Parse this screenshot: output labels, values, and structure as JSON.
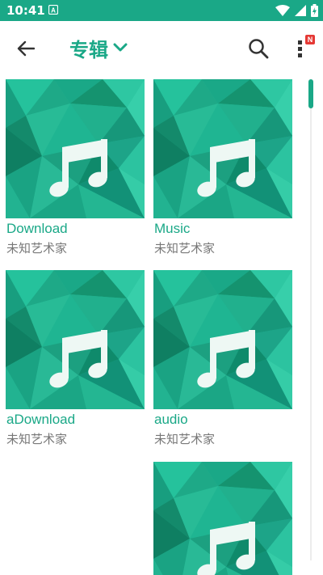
{
  "status_bar": {
    "time": "10:41",
    "icons": [
      "a-app-icon",
      "wifi-icon",
      "signal-icon",
      "battery-charging-icon"
    ]
  },
  "app_bar": {
    "title": "专辑",
    "back_icon": "arrow-left-icon",
    "dropdown_icon": "chevron-down-icon",
    "search_icon": "search-icon",
    "more_icon": "more-vert-icon",
    "badge": "N"
  },
  "albums": [
    {
      "title": "Download",
      "artist": "未知艺术家",
      "cover_icon": "music-note-icon"
    },
    {
      "title": "Music",
      "artist": "未知艺术家",
      "cover_icon": "music-note-icon"
    },
    {
      "title": "aDownload",
      "artist": "未知艺术家",
      "cover_icon": "music-note-icon"
    },
    {
      "title": "audio",
      "artist": "未知艺术家",
      "cover_icon": "music-note-icon"
    },
    {
      "title": "",
      "artist": "",
      "cover_icon": "music-note-icon"
    }
  ],
  "colors": {
    "accent": "#1aa887",
    "status_bar": "#1aa887",
    "secondary_text": "#777777",
    "badge": "#e53935"
  }
}
